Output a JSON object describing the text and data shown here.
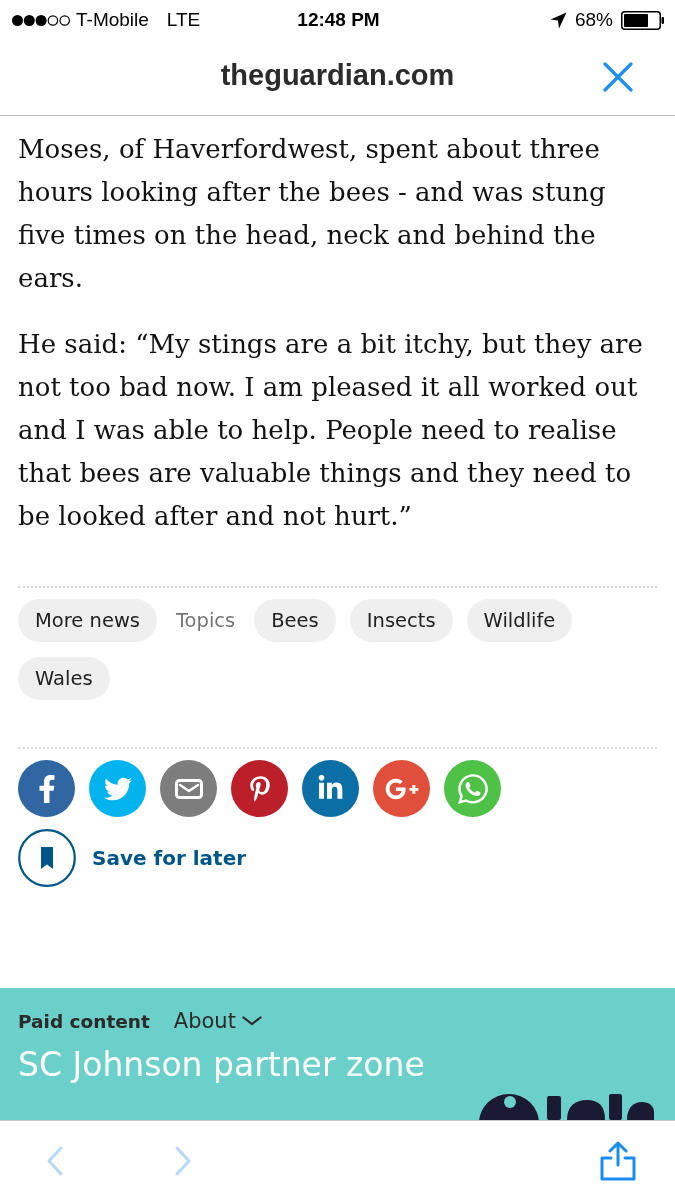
{
  "status_bar": {
    "carrier": "T-Mobile",
    "network": "LTE",
    "time": "12:48 PM",
    "battery": "68%"
  },
  "header": {
    "title": "theguardian.com"
  },
  "article": {
    "paragraphs": [
      "Moses, of Haverfordwest, spent about three hours looking after the bees - and was stung five times on the head, neck and behind the ears.",
      "He said: “My stings are a bit itchy, but they are not too bad now. I am pleased it all worked out and I was able to help. People need to realise that bees are valuable things and they need to be looked after and not hurt.”"
    ]
  },
  "tags": [
    {
      "kind": "link",
      "label": "More news"
    },
    {
      "kind": "heading",
      "label": "Topics"
    },
    {
      "kind": "link",
      "label": "Bees"
    },
    {
      "kind": "link",
      "label": "Insects"
    },
    {
      "kind": "link",
      "label": "Wildlife"
    },
    {
      "kind": "link",
      "label": "Wales"
    }
  ],
  "share": {
    "buttons": [
      {
        "kind": "facebook",
        "color": "#3067a3"
      },
      {
        "kind": "twitter",
        "color": "#03b3ee"
      },
      {
        "kind": "email",
        "color": "#7d7d7d"
      },
      {
        "kind": "pinterest",
        "color": "#bb1f2a"
      },
      {
        "kind": "linkedin",
        "color": "#0b6fa6"
      },
      {
        "kind": "googleplus",
        "color": "#e04f3b"
      },
      {
        "kind": "whatsapp",
        "color": "#4dc247"
      }
    ]
  },
  "save": {
    "label": "Save for later"
  },
  "paid_content": {
    "label": "Paid content",
    "about": "About",
    "title": "SC Johnson partner zone"
  },
  "toolbar": {
    "back": {
      "disabled": true
    },
    "forward": {
      "disabled": true
    }
  }
}
